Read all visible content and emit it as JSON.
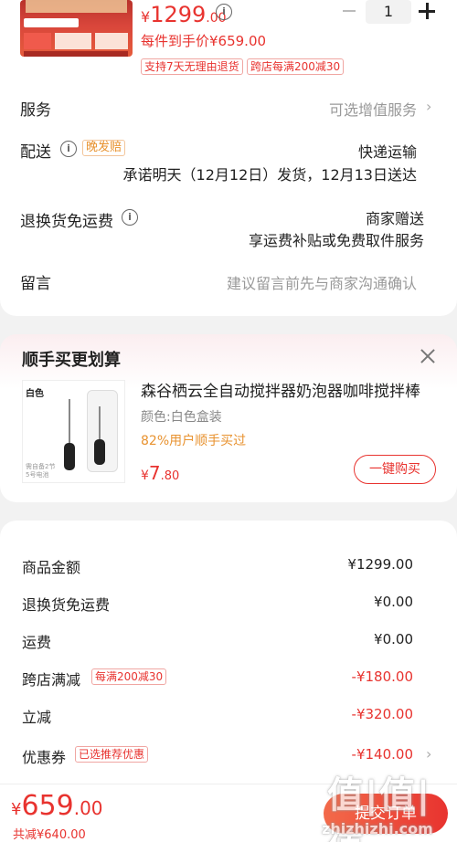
{
  "product": {
    "unit_price_symbol": "¥",
    "unit_price_int": "1299",
    "unit_price_dec": ".00",
    "info_icon": "i",
    "hand_price": "每件到手价¥659.00",
    "quantity": "1",
    "tags": [
      "支持7天无理由退货",
      "跨店每满200减30"
    ]
  },
  "rows": {
    "service_label": "服务",
    "service_value": "可选增值服务",
    "delivery_label": "配送",
    "delivery_tag": "晚发赔",
    "delivery_method": "快递运输",
    "delivery_promise": "承诺明天（12月12日）发货，12月13日送达",
    "return_label": "退换货免运费",
    "return_value1": "商家赠送",
    "return_value2": "享运费补贴或免费取件服务",
    "message_label": "留言",
    "message_placeholder": "建议留言前先与商家沟通确认"
  },
  "upsell": {
    "title": "顺手买更划算",
    "image_label": "白色",
    "image_caption": "需自备2节 5号电池",
    "name": "森谷栖云全自动搅拌器奶泡器咖啡搅拌棒",
    "variant": "颜色:白色盒装",
    "bought": "82%用户顺手买过",
    "price_symbol": "¥",
    "price_int": "7",
    "price_dec": ".80",
    "buy_label": "一键购买"
  },
  "summary": {
    "items": [
      {
        "label": "商品金额",
        "value": "¥1299.00",
        "red": false,
        "tag": ""
      },
      {
        "label": "退换货免运费",
        "value": "¥0.00",
        "red": false,
        "tag": ""
      },
      {
        "label": "运费",
        "value": "¥0.00",
        "red": false,
        "tag": ""
      },
      {
        "label": "跨店满减",
        "value": "-¥180.00",
        "red": true,
        "tag": "每满200减30"
      },
      {
        "label": "立减",
        "value": "-¥320.00",
        "red": true,
        "tag": ""
      },
      {
        "label": "优惠券",
        "value": "-¥140.00",
        "red": true,
        "tag": "已选推荐优惠"
      }
    ]
  },
  "bottom": {
    "total_symbol": "¥",
    "total_int": "659",
    "total_dec": ".00",
    "saved": "共减¥640.00",
    "submit": "提交订单",
    "watermark_logo": "值|值|值",
    "watermark_url": "zhizhizhi.com"
  },
  "colors": {
    "accent_red": "#e8332f",
    "orange": "#e8922f",
    "background": "#f2f2f2"
  },
  "icons": [
    "info-icon",
    "chevron-right-icon",
    "close-icon",
    "minus-icon",
    "plus-icon"
  ]
}
